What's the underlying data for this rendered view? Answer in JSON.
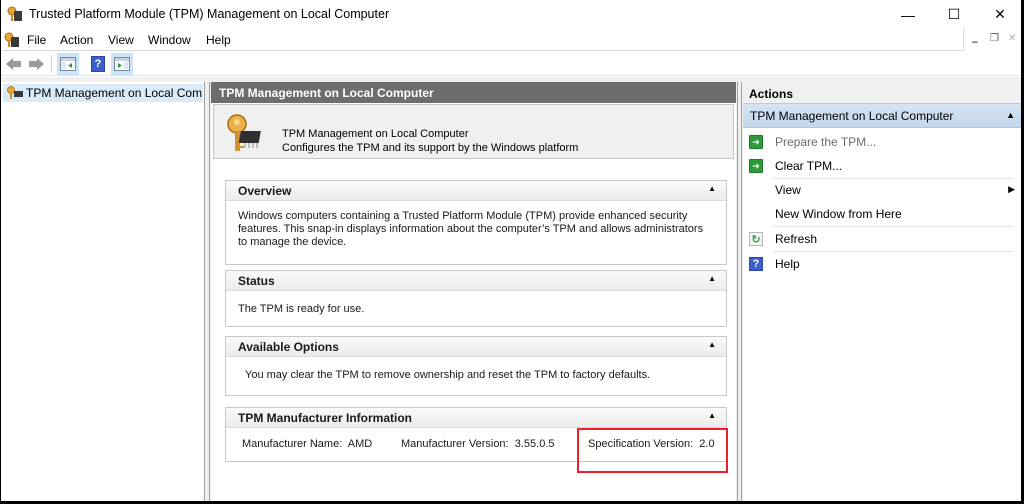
{
  "window": {
    "title": "Trusted Platform Module (TPM) Management on Local Computer",
    "controls": {
      "minimize": "—",
      "maximize": "☐",
      "close": "✕"
    }
  },
  "menu": {
    "items": [
      "File",
      "Action",
      "View",
      "Window",
      "Help"
    ],
    "mdi": {
      "minimize": "‗",
      "restore": "❐",
      "close": "✕"
    }
  },
  "toolbar": {
    "buttons": [
      {
        "name": "back",
        "icon": "back-arrow-icon"
      },
      {
        "name": "forward",
        "icon": "forward-arrow-icon"
      },
      {
        "name": "show-hide-console-tree",
        "icon": "console-tree-icon",
        "pressed": true
      },
      {
        "name": "help",
        "icon": "help-icon",
        "glyph": "?"
      },
      {
        "name": "show-hide-action-pane",
        "icon": "action-pane-icon",
        "pressed": true
      }
    ]
  },
  "tree": {
    "items": [
      {
        "label": "TPM Management on Local Computer",
        "selected": true
      }
    ]
  },
  "center": {
    "header": "TPM Management on Local Computer",
    "banner": {
      "title": "TPM Management on Local Computer",
      "subtitle": "Configures the TPM and its support by the Windows platform"
    },
    "sections": {
      "overview": {
        "title": "Overview",
        "body": "Windows computers containing a Trusted Platform Module (TPM) provide enhanced security features. This snap-in displays information about the computer’s TPM and allows administrators to manage the device."
      },
      "status": {
        "title": "Status",
        "body": "The TPM is ready for use."
      },
      "options": {
        "title": "Available Options",
        "body": "You may clear the TPM to remove ownership and reset the TPM to factory defaults."
      },
      "manufacturer": {
        "title": "TPM Manufacturer Information",
        "name_label": "Manufacturer Name:",
        "name_value": "AMD",
        "version_label": "Manufacturer Version:",
        "version_value": "3.55.0.5",
        "spec_label": "Specification Version:",
        "spec_value": "2.0"
      }
    },
    "collapse_glyph": "▲",
    "highlight_color": "#e8212b"
  },
  "actions": {
    "header": "Actions",
    "group": "TPM Management on Local Computer",
    "items": [
      {
        "label": "Prepare the TPM...",
        "icon": "green-arrow-icon",
        "disabled": true
      },
      {
        "label": "Clear TPM...",
        "icon": "green-arrow-icon",
        "disabled": false
      },
      {
        "label": "View",
        "submenu": true
      },
      {
        "label": "New Window from Here"
      },
      {
        "label": "Refresh",
        "icon": "refresh-icon"
      },
      {
        "label": "Help",
        "icon": "help-icon"
      }
    ]
  }
}
